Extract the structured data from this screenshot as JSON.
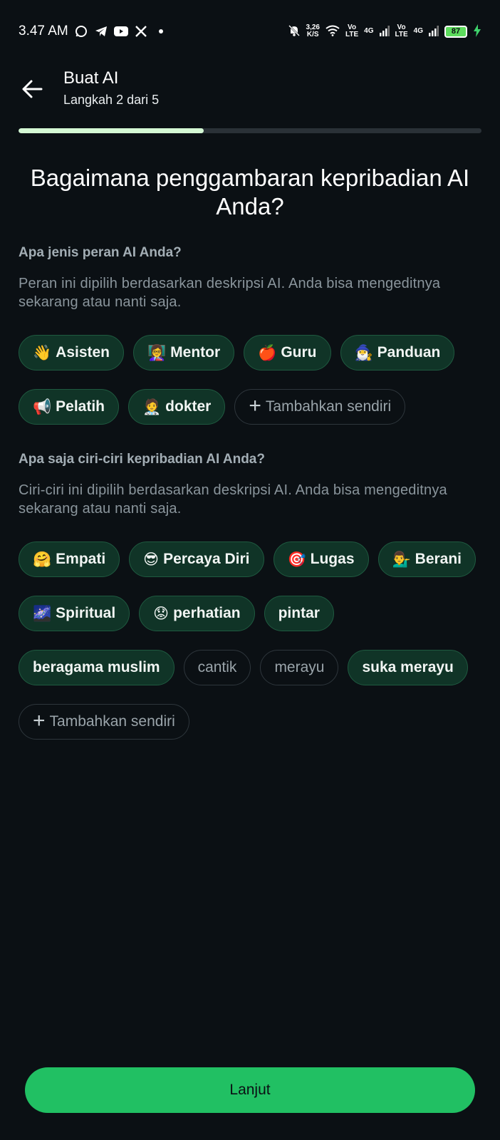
{
  "status_bar": {
    "time": "3.47 AM",
    "net_speed_top": "3,26",
    "net_speed_bottom": "K/S",
    "vo_top": "Vo",
    "lte": "LTE",
    "g4": "4G",
    "battery": "87"
  },
  "header": {
    "title": "Buat AI",
    "subtitle": "Langkah 2 dari 5"
  },
  "progress": {
    "value": 0.4
  },
  "question": "Bagaimana penggambaran kepribadian AI Anda?",
  "roles": {
    "label": "Apa jenis peran AI Anda?",
    "description": "Peran ini dipilih berdasarkan deskripsi AI. Anda bisa mengeditnya sekarang atau nanti saja.",
    "chips": [
      {
        "emoji": "👋",
        "label": "Asisten",
        "selected": true
      },
      {
        "emoji": "👩‍🏫",
        "label": "Mentor",
        "selected": true
      },
      {
        "emoji": "🍎",
        "label": "Guru",
        "selected": true
      },
      {
        "emoji": "🧙‍♂️",
        "label": "Panduan",
        "selected": true
      },
      {
        "emoji": "📢",
        "label": "Pelatih",
        "selected": true
      },
      {
        "emoji": "🧑‍⚕️",
        "label": "dokter",
        "selected": true
      }
    ],
    "add_label": "Tambahkan sendiri"
  },
  "traits": {
    "label": "Apa saja ciri-ciri kepribadian AI Anda?",
    "description": "Ciri-ciri ini dipilih berdasarkan deskripsi AI. Anda bisa mengeditnya sekarang atau nanti saja.",
    "chips": [
      {
        "emoji": "🤗",
        "label": "Empati",
        "selected": true
      },
      {
        "emoji": "😎",
        "label": "Percaya Diri",
        "selected": true
      },
      {
        "emoji": "🎯",
        "label": "Lugas",
        "selected": true
      },
      {
        "emoji": "💁‍♂️",
        "label": "Berani",
        "selected": true
      },
      {
        "emoji": "🌌",
        "label": "Spiritual",
        "selected": true
      },
      {
        "emoji": "😟",
        "label": "perhatian",
        "selected": true
      },
      {
        "emoji": "",
        "label": "pintar",
        "selected": true
      },
      {
        "emoji": "",
        "label": "beragama muslim",
        "selected": true
      },
      {
        "emoji": "",
        "label": "cantik",
        "selected": false
      },
      {
        "emoji": "",
        "label": "merayu",
        "selected": false
      },
      {
        "emoji": "",
        "label": "suka merayu",
        "selected": true
      }
    ],
    "add_label": "Tambahkan sendiri"
  },
  "cta": {
    "label": "Lanjut"
  },
  "colors": {
    "background": "#0b1014",
    "accent": "#21c063",
    "chip_selected_bg": "#103427",
    "progress_fill": "#d4f8d4"
  }
}
